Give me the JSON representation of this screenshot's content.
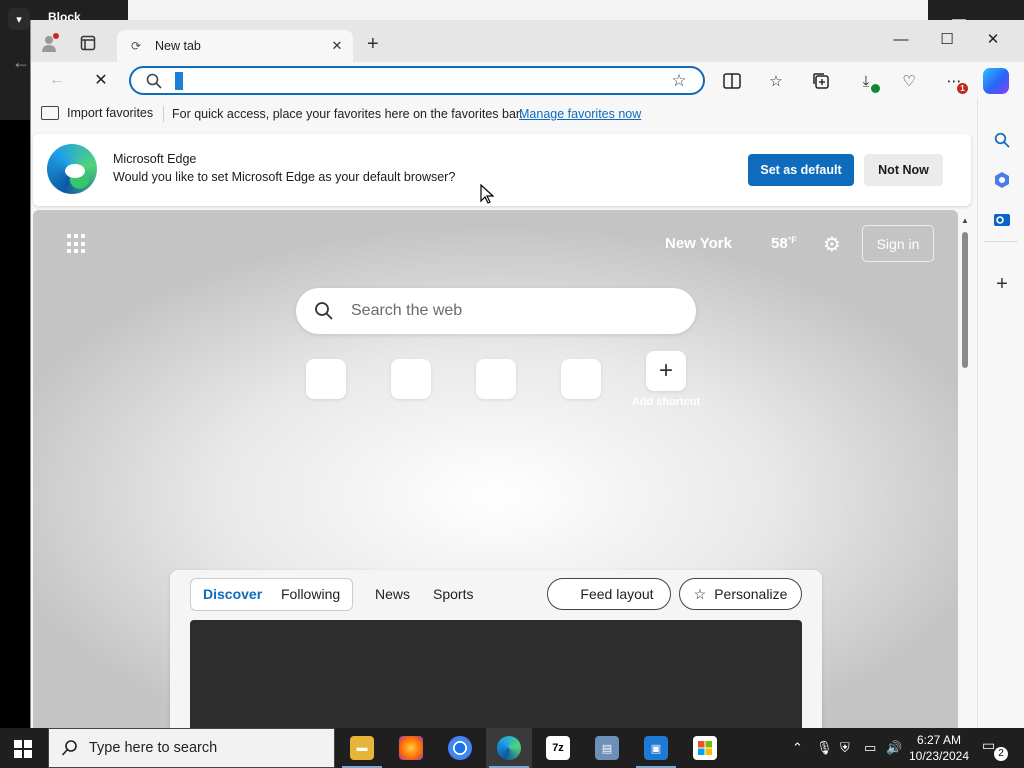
{
  "background": {
    "title": "Block"
  },
  "tab": {
    "label": "New tab"
  },
  "address_bar": {
    "value": "",
    "placeholder": ""
  },
  "favorites_bar": {
    "import_label": "Import favorites",
    "message": "For quick access, place your favorites here on the favorites bar.",
    "manage_link": "Manage favorites now"
  },
  "downloads_badge": "1",
  "banner": {
    "title": "Microsoft Edge",
    "text": "Would you like to set Microsoft Edge as your default browser?",
    "primary_button": "Set as default",
    "secondary_button": "Not Now"
  },
  "newtab": {
    "city": "New York",
    "temperature": "58",
    "temperature_unit": "°F",
    "signin_label": "Sign in",
    "search_placeholder": "Search the web",
    "add_shortcut_label": "Add shortcut"
  },
  "feed": {
    "tabs": [
      "Discover",
      "Following",
      "News",
      "Sports"
    ],
    "active_tab": "Discover",
    "feed_layout_label": "Feed layout",
    "personalize_label": "Personalize"
  },
  "taskbar": {
    "search_text": "Type here to search",
    "time": "6:27 AM",
    "date": "10/23/2024",
    "notification_count": "2",
    "apps": [
      "file-explorer",
      "firefox",
      "chrome",
      "edge",
      "7zip",
      "network",
      "remote-desktop",
      "store"
    ]
  },
  "colors": {
    "accent": "#0f6cbd",
    "badge": "#c42b1c"
  }
}
